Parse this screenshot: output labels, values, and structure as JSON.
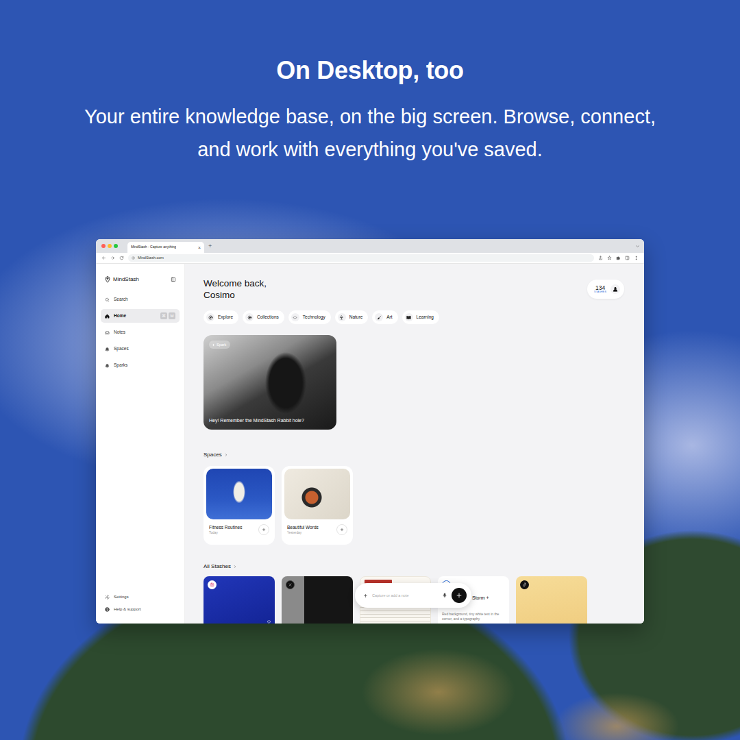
{
  "promo": {
    "headline": "On Desktop, too",
    "subtitle_lines": [
      "Your entire knowledge base, on the big screen. Browse, connect,",
      "and work with everything you've saved."
    ]
  },
  "browser": {
    "tabs": [
      {
        "label": "MindStash - Capture anything",
        "selected": true
      }
    ],
    "tab_close": "×",
    "new_tab": "+",
    "address": "MindStash.com"
  },
  "sidebar": {
    "logo": "MindStash",
    "items": [
      {
        "label": "Search",
        "selected": false,
        "keys": []
      },
      {
        "label": "Home",
        "selected": true,
        "keys": [
          "⌘",
          "M"
        ]
      },
      {
        "label": "Notes",
        "selected": false,
        "keys": []
      },
      {
        "label": "Spaces",
        "selected": false,
        "keys": []
      },
      {
        "label": "Sparks",
        "selected": false,
        "keys": []
      }
    ],
    "footer_items": [
      {
        "label": "Settings"
      },
      {
        "label": "Help & support"
      }
    ]
  },
  "header": {
    "greeting_lines": [
      "Welcome back,",
      "Cosimo"
    ],
    "stash_count": "134",
    "stash_label": "STASHES"
  },
  "chips": [
    {
      "label": "Explore"
    },
    {
      "label": "Collections"
    },
    {
      "label": "Technology"
    },
    {
      "label": "Nature"
    },
    {
      "label": "Art"
    },
    {
      "label": "Learning"
    }
  ],
  "spark": {
    "badge": "Spark",
    "caption": "Hey! Remember the MindStash Rabbit hole?"
  },
  "spaces": {
    "title": "Spaces",
    "items": [
      {
        "title": "Fitness Routines",
        "date": "Today"
      },
      {
        "title": "Beautiful Words",
        "date": "Yesterday"
      }
    ]
  },
  "all_stashes": {
    "title": "All Stashes",
    "items": [
      {
        "kind": "instagram"
      },
      {
        "kind": "x"
      },
      {
        "kind": "document"
      },
      {
        "kind": "note",
        "title": "Storm +",
        "description": "Red background, tiny white text in the corner, and a typography"
      },
      {
        "kind": "tiktok"
      }
    ]
  },
  "capture": {
    "placeholder": "Capture or add a note"
  }
}
